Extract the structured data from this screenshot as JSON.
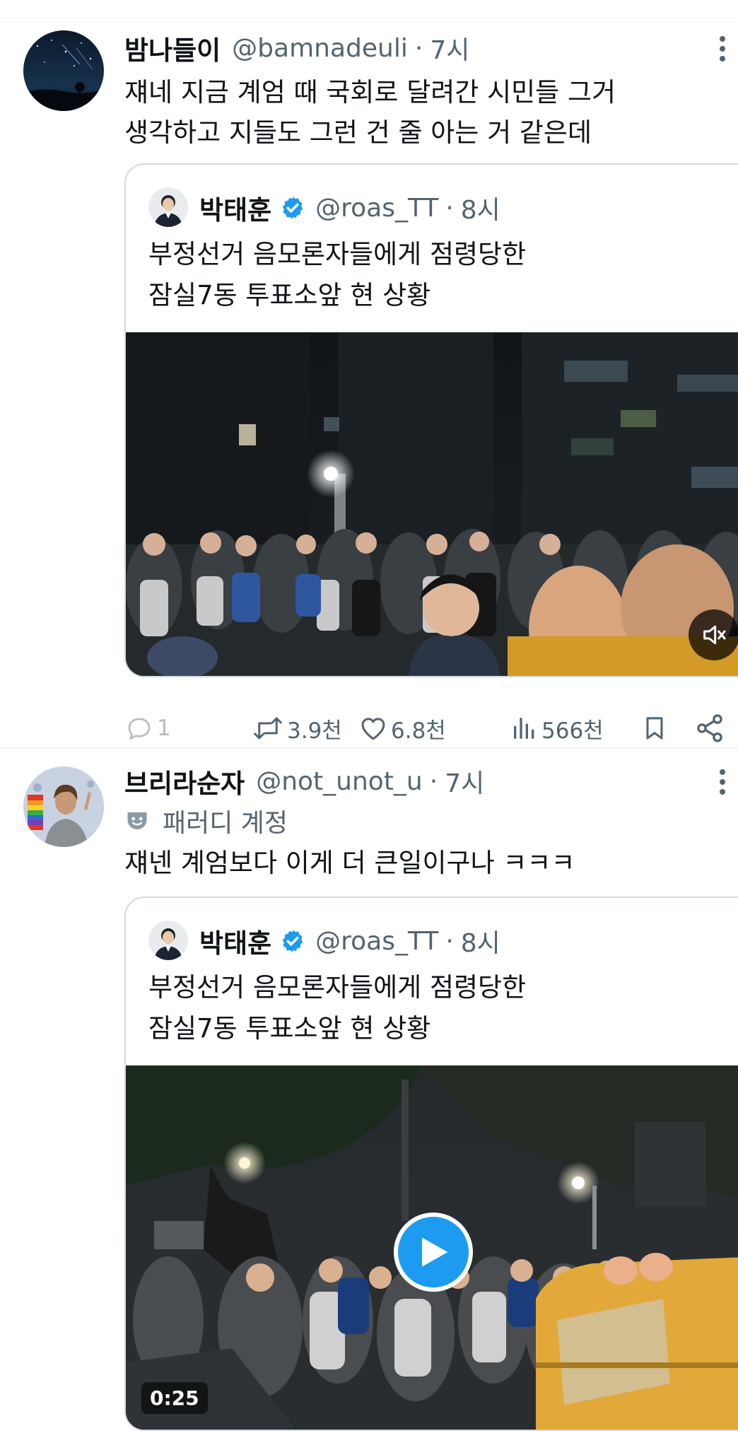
{
  "posts": [
    {
      "display_name": "밤나들이",
      "handle": "@bamnadeuli",
      "separator": "·",
      "time": "7시",
      "text": "쟤네 지금 계엄 때 국회로 달려간 시민들 그거\n생각하고 지들도 그런 건 줄 아는 거 같은데",
      "quote": {
        "display_name": "박태훈",
        "handle": "@roas_TT",
        "separator": "·",
        "time": "8시",
        "text": "부정선거 음모론자들에게 점령당한\n잠실7동 투표소앞 현 상황"
      },
      "actions": {
        "reply_count": "1",
        "repost_count": "3.9천",
        "like_count": "6.8천",
        "view_count": "566천"
      }
    },
    {
      "display_name": "브리라순자",
      "handle": "@not_unot_u",
      "separator": "·",
      "time": "7시",
      "parody_label": "패러디 계정",
      "text": "쟤넨 계엄보다 이게 더 큰일이구나 ㅋㅋㅋ",
      "quote": {
        "display_name": "박태훈",
        "handle": "@roas_TT",
        "separator": "·",
        "time": "8시",
        "text": "부정선거 음모론자들에게 점령당한\n잠실7동 투표소앞 현 상황",
        "video_duration": "0:25"
      }
    }
  ],
  "icons": {
    "more": "more-vertical-icon",
    "verified": "verified-badge-icon",
    "mute": "volume-muted-icon",
    "play": "play-icon",
    "reply": "reply-icon",
    "repost": "repost-icon",
    "like": "heart-icon",
    "views": "views-chart-icon",
    "bookmark": "bookmark-icon",
    "share": "share-icon",
    "parody": "theater-mask-icon"
  },
  "colors": {
    "text_primary": "#0f1419",
    "text_secondary": "#536471",
    "verified_blue": "#1d9bf0",
    "border": "#cfd9de"
  }
}
